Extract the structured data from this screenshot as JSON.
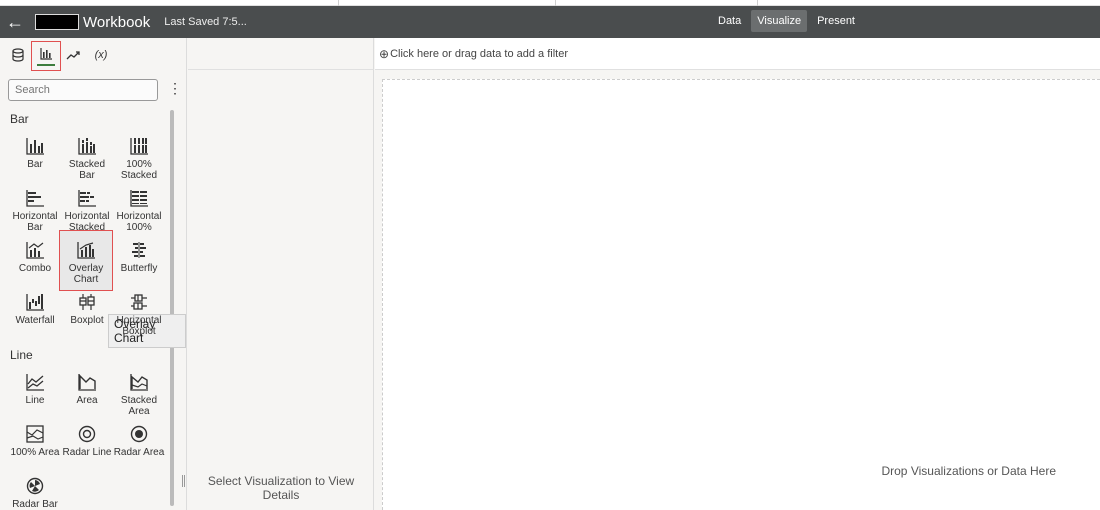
{
  "header": {
    "back_icon": "back-arrow-icon",
    "title": "Workbook",
    "saved": "Last Saved 7:5...",
    "tabs": [
      {
        "label": "Data",
        "active": false
      },
      {
        "label": "Visualize",
        "active": true
      },
      {
        "label": "Present",
        "active": false
      }
    ]
  },
  "tools": [
    {
      "icon": "database-icon",
      "selected": false
    },
    {
      "icon": "bar-chart-icon",
      "selected": true
    },
    {
      "icon": "analytics-icon",
      "selected": false
    },
    {
      "icon": "calculation-icon",
      "label": "(x)",
      "selected": false
    }
  ],
  "search": {
    "placeholder": "Search"
  },
  "sections": {
    "bar": "Bar",
    "line": "Line"
  },
  "bar_items": [
    {
      "label": "Bar",
      "icon": "bar-icon"
    },
    {
      "label": "Stacked Bar",
      "icon": "stacked-bar-icon"
    },
    {
      "label": "100% Stacked",
      "icon": "stacked-100-icon"
    },
    {
      "label": "Horizontal Bar",
      "icon": "horizontal-bar-icon"
    },
    {
      "label": "Horizontal Stacked",
      "icon": "horizontal-stacked-icon"
    },
    {
      "label": "Horizontal 100%",
      "icon": "horizontal-100-icon"
    },
    {
      "label": "Combo",
      "icon": "combo-icon"
    },
    {
      "label": "Overlay Chart",
      "icon": "overlay-chart-icon",
      "selected": true
    },
    {
      "label": "Butterfly",
      "icon": "butterfly-icon"
    },
    {
      "label": "Waterfall",
      "icon": "waterfall-icon"
    },
    {
      "label": "Boxplot",
      "icon": "boxplot-icon"
    },
    {
      "label": "Horizontal Boxplot",
      "icon": "horizontal-boxplot-icon"
    }
  ],
  "line_items": [
    {
      "label": "Line",
      "icon": "line-icon"
    },
    {
      "label": "Area",
      "icon": "area-icon"
    },
    {
      "label": "Stacked Area",
      "icon": "stacked-area-icon"
    },
    {
      "label": "100% Area",
      "icon": "area-100-icon"
    },
    {
      "label": "Radar Line",
      "icon": "radar-line-icon"
    },
    {
      "label": "Radar Area",
      "icon": "radar-area-icon"
    },
    {
      "label": "Radar Bar",
      "icon": "radar-bar-icon"
    }
  ],
  "tooltip": "Overlay Chart",
  "details": {
    "text": "Select Visualization to View Details"
  },
  "filter": {
    "text": "Click here or drag data to add a filter"
  },
  "canvas": {
    "drop_text": "Drop Visualizations or Data Here"
  }
}
